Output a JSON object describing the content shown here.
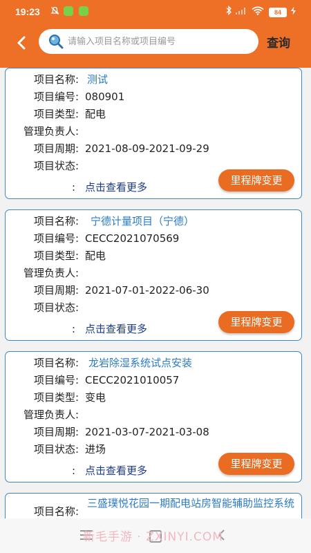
{
  "status_bar": {
    "time": "19:23",
    "battery": "84"
  },
  "search": {
    "placeholder": "请输入项目名称或项目编号",
    "value": "",
    "button_label": "查询"
  },
  "labels": {
    "name": "项目名称:",
    "code": "项目编号:",
    "type": "项目类型:",
    "manager": "管理负责人:",
    "period": "项目周期:",
    "status": "项目状态:",
    "more_colon": ":",
    "more": "点击查看更多",
    "change_button": "里程牌变更"
  },
  "projects": [
    {
      "name": "测试",
      "code": "080901",
      "type": "配电",
      "manager": "",
      "period": "2021-08-09-2021-09-29",
      "status": ""
    },
    {
      "name": "宁德计量项目（宁德）",
      "code": "CECC2021070569",
      "type": "配电",
      "manager": "",
      "period": "2021-07-01-2022-06-30",
      "status": ""
    },
    {
      "name": "龙岩除湿系统试点安装",
      "code": "CECC2021010057",
      "type": "变电",
      "manager": "",
      "period": "2021-03-07-2021-03-08",
      "status": "进场"
    },
    {
      "name": "三盛璞悦花园一期配电站房智能辅助监控系统",
      "code": "",
      "type": "",
      "manager": "",
      "period": "",
      "status": ""
    }
  ],
  "watermark": "新毛手游 · ZXINYI.COM"
}
